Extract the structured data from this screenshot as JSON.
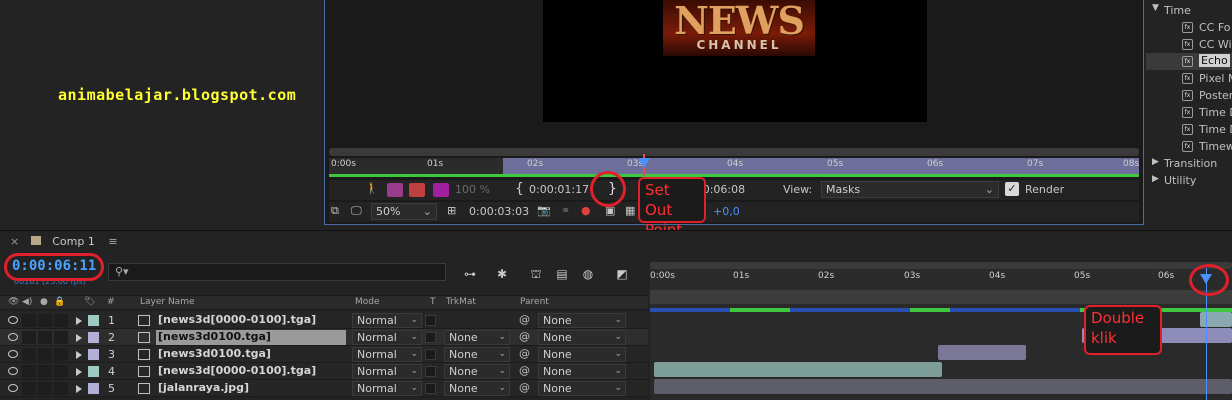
{
  "watermark": "animabelajar.blogspot.com",
  "logo": {
    "line1": "NEWS",
    "line2": "CHANNEL"
  },
  "viewer": {
    "ruler_ticks": [
      "0:00s",
      "01s",
      "02s",
      "03s",
      "04s",
      "05s",
      "06s",
      "07s",
      "08s"
    ],
    "zoom_percent": "100 %",
    "in_time": "0:00:01:17",
    "out_time": "0:00:06:08",
    "view_label": "View:",
    "view_value": "Masks",
    "render_label": "Render",
    "magnification": "50%",
    "current_time": "0:00:03:03",
    "exposure": "+0,0"
  },
  "callouts": {
    "set_out_point": "Set Out Point",
    "double_klik": "Double klik"
  },
  "effects": {
    "category_time": "Time",
    "items": [
      "CC Fo",
      "CC Wi",
      "Echo",
      "Pixel M",
      "Poster",
      "Time D",
      "Time D",
      "Timew"
    ],
    "category_transition": "Transition",
    "category_utility": "Utility"
  },
  "timeline": {
    "comp_tab": "Comp 1",
    "timecode": "0:00:06:11",
    "fps": "00161 (25.00 fps)",
    "ruler_ticks": [
      "0:00s",
      "01s",
      "02s",
      "03s",
      "04s",
      "05s",
      "06s"
    ],
    "columns": {
      "number": "#",
      "layer_name": "Layer Name",
      "mode": "Mode",
      "t": "T",
      "trkmat": "TrkMat",
      "parent": "Parent"
    },
    "layers": [
      {
        "num": "1",
        "name": "[news3d[0000-0100].tga]",
        "mode": "Normal",
        "trkmat": "",
        "parent": "None",
        "color": "#9fcac2"
      },
      {
        "num": "2",
        "name": "[news3d0100.tga]",
        "mode": "Normal",
        "trkmat": "None",
        "parent": "None",
        "color": "#b3b0d8"
      },
      {
        "num": "3",
        "name": "[news3d0100.tga]",
        "mode": "Normal",
        "trkmat": "None",
        "parent": "None",
        "color": "#b3b0d8"
      },
      {
        "num": "4",
        "name": "[news3d[0000-0100].tga]",
        "mode": "Normal",
        "trkmat": "None",
        "parent": "None",
        "color": "#9fcac2"
      },
      {
        "num": "5",
        "name": "[jalanraya.jpg]",
        "mode": "Normal",
        "trkmat": "None",
        "parent": "None",
        "color": "#b3b0d8"
      }
    ]
  },
  "colors": {
    "accent_blue": "#4a90ff",
    "annotation_red": "#e0202a",
    "watermark_yellow": "#ffff33"
  }
}
